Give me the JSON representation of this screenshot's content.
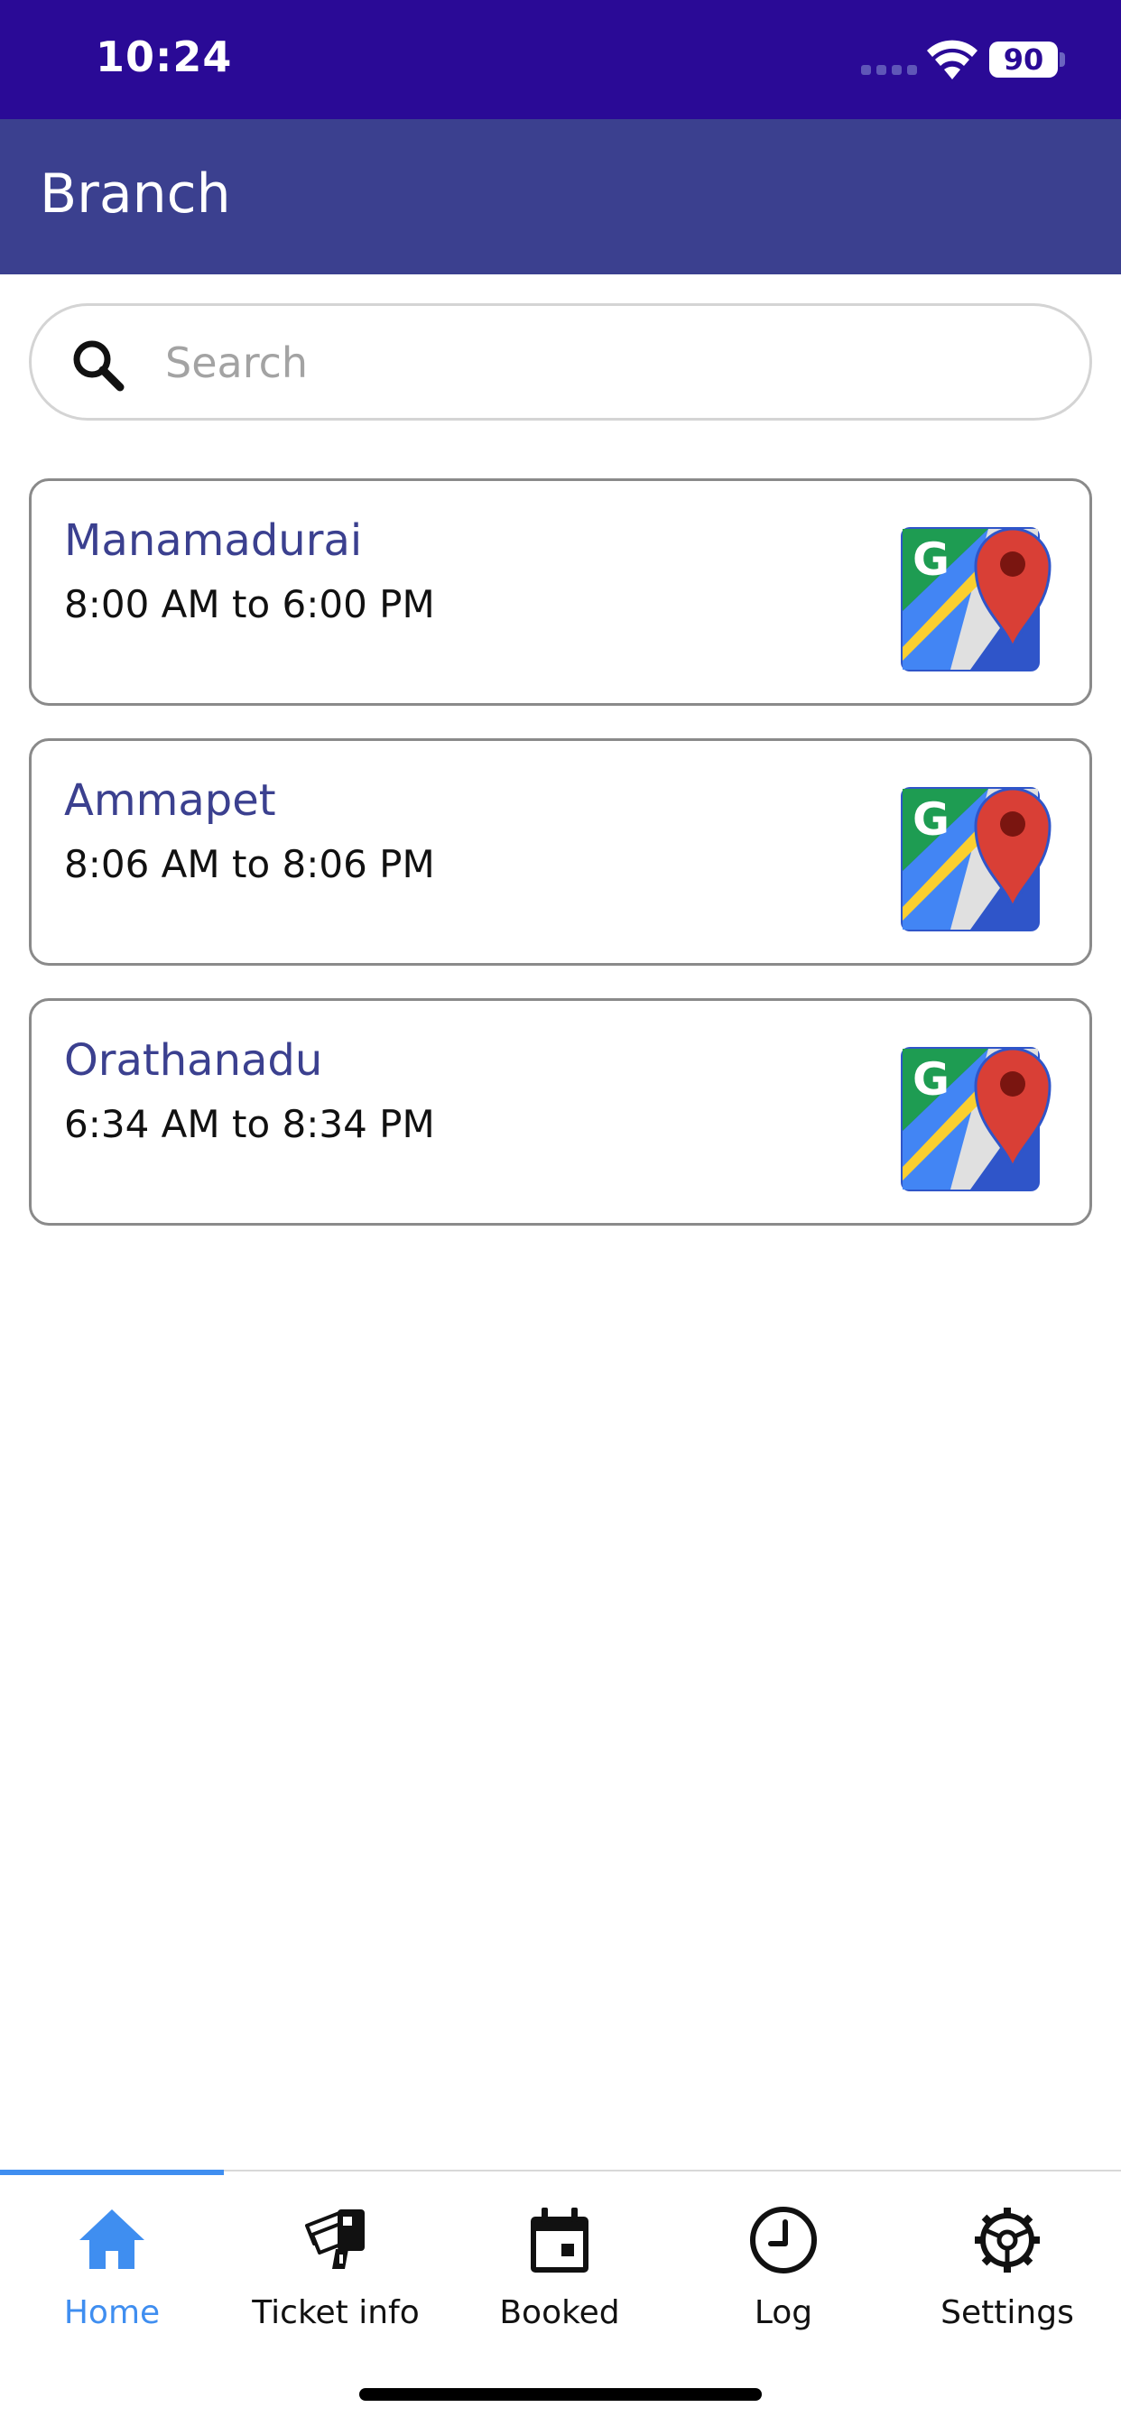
{
  "status_bar": {
    "time": "10:24",
    "battery": "90"
  },
  "header": {
    "title": "Branch"
  },
  "search": {
    "placeholder": "Search",
    "value": ""
  },
  "branches": [
    {
      "name": "Manamadurai",
      "hours": "8:00 AM to 6:00 PM",
      "icon": "google-maps-icon"
    },
    {
      "name": "Ammapet",
      "hours": "8:06 AM to 8:06 PM",
      "icon": "google-maps-icon"
    },
    {
      "name": "Orathanadu",
      "hours": "6:34 AM to 8:34 PM",
      "icon": "google-maps-icon"
    }
  ],
  "bottom_nav": {
    "active": "Home",
    "items": [
      {
        "label": "Home",
        "icon": "home-icon"
      },
      {
        "label": "Ticket info",
        "icon": "ticket-icon"
      },
      {
        "label": "Booked",
        "icon": "calendar-icon"
      },
      {
        "label": "Log",
        "icon": "clock-icon"
      },
      {
        "label": "Settings",
        "icon": "gear-icon"
      }
    ]
  },
  "colors": {
    "status_bar": "#2a0a96",
    "header": "#3b408f",
    "branch_name": "#3b408f",
    "nav_active": "#3f8ef0"
  }
}
